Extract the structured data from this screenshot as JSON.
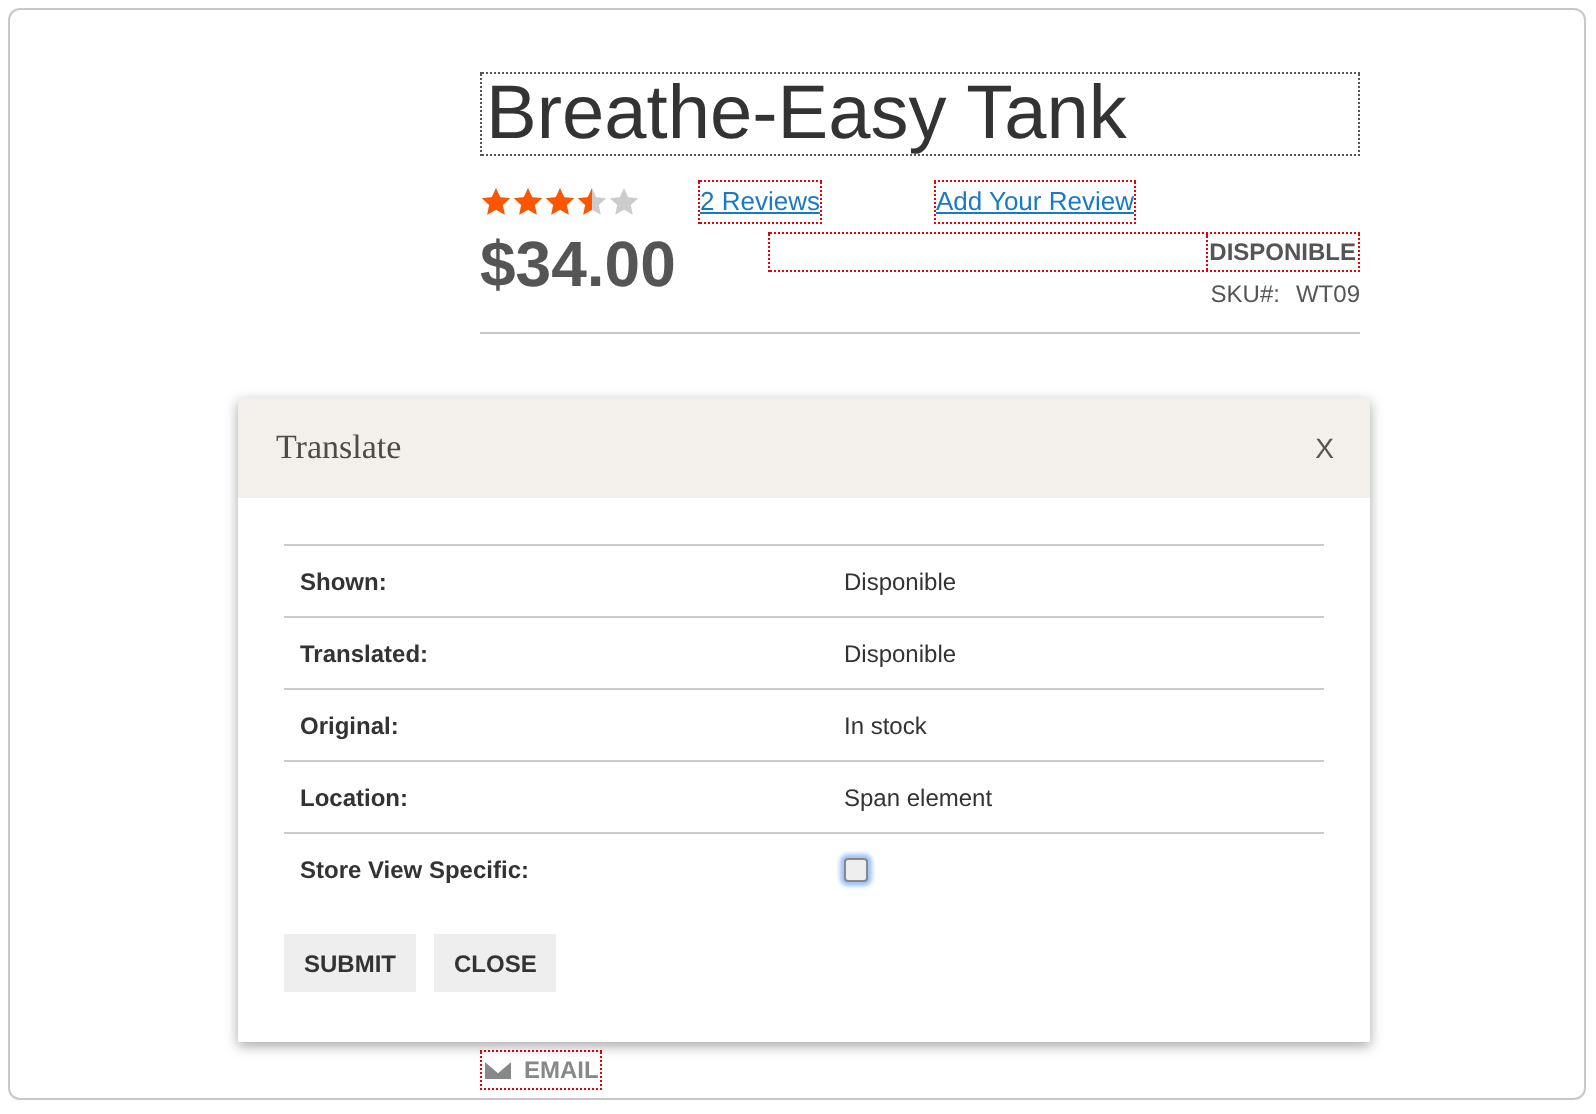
{
  "product": {
    "title": "Breathe-Easy Tank",
    "stars": 3.5,
    "reviews_link": "2 Reviews",
    "add_review_link": "Add Your Review",
    "price": "$34.00",
    "stock": "DISPONIBLE",
    "sku_label": "SKU#:",
    "sku": "WT09"
  },
  "dialog": {
    "title": "Translate",
    "close": "X",
    "rows": [
      {
        "kind": "text",
        "label": "Shown:",
        "value": "Disponible"
      },
      {
        "kind": "text",
        "label": "Translated:",
        "value": "Disponible"
      },
      {
        "kind": "text",
        "label": "Original:",
        "value": "In stock"
      },
      {
        "kind": "text",
        "label": "Location:",
        "value": "Span element"
      },
      {
        "kind": "checkbox",
        "label": "Store View Specific:",
        "checked": false
      }
    ],
    "buttons": [
      "SUBMIT",
      "CLOSE"
    ]
  },
  "email_link": "EMAIL"
}
